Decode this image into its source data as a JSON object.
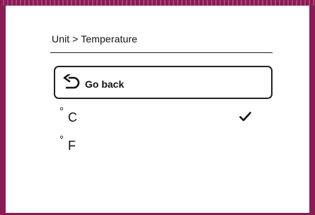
{
  "breadcrumb": "Unit > Temperature",
  "back_button": {
    "label": "Go back",
    "icon": "undo-arrow-icon"
  },
  "options": [
    {
      "symbol": "°",
      "unit": "C",
      "selected": true
    },
    {
      "symbol": "°",
      "unit": "F",
      "selected": false
    }
  ],
  "selected_icon": "check-icon",
  "colors": {
    "frame": "#8a1c55",
    "text": "#111111"
  }
}
